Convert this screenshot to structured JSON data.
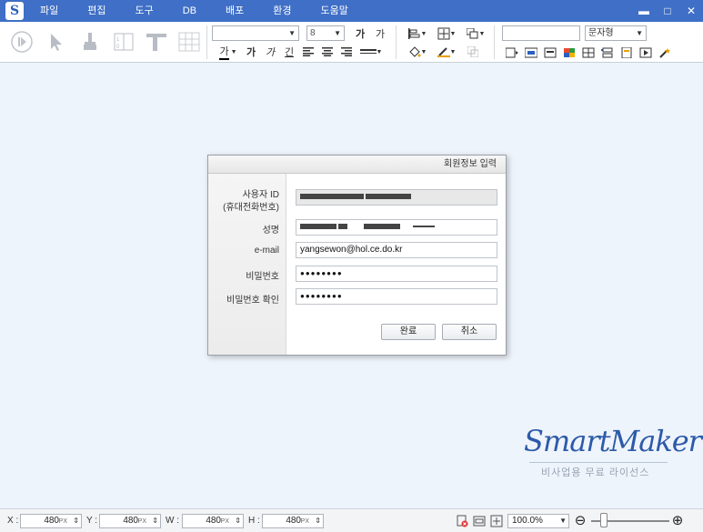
{
  "menu": {
    "items": [
      {
        "label": "파일"
      },
      {
        "label": "편집"
      },
      {
        "label": "도구"
      },
      {
        "label": "DB"
      },
      {
        "label": "배포"
      },
      {
        "label": "환경"
      },
      {
        "label": "도움말"
      }
    ]
  },
  "window_controls": {
    "minimize": "▬",
    "restore": "□",
    "close": "✕"
  },
  "toolbar": {
    "font_name": "",
    "font_size": "8",
    "style_dropdown": "문자형",
    "text_style_box": "",
    "font_color_glyph": "가",
    "bold_glyph": "가",
    "italic_glyph": "가",
    "underline_glyph": "긴",
    "size_up_glyph": "가",
    "size_down_glyph": "가"
  },
  "dialog": {
    "title": "회원정보 입력",
    "fields": [
      {
        "label_line1": "사용자 ID",
        "label_line2": "(휴대전화번호)",
        "value": ""
      },
      {
        "label": "성명",
        "value": ""
      },
      {
        "label": "e-mail",
        "value": "yangsewon@hol.ce.do.kr"
      },
      {
        "label": "비밀번호",
        "value": "●●●●●●●●"
      },
      {
        "label": "비밀번호 확인",
        "value": "●●●●●●●●"
      }
    ],
    "confirm_label": "완료",
    "cancel_label": "취소"
  },
  "watermark": {
    "logo": "SmartMaker",
    "subtitle": "비사업용 무료 라이선스"
  },
  "statusbar": {
    "x_label": "X :",
    "x_value": "480",
    "x_unit": "PX",
    "y_label": "Y :",
    "y_value": "480",
    "y_unit": "PX",
    "w_label": "W :",
    "w_value": "480",
    "w_unit": "PX",
    "h_label": "H :",
    "h_value": "480",
    "h_unit": "PX",
    "zoom": "100.0%",
    "zoom_minus": "⊖",
    "zoom_plus": "⊕"
  },
  "colors": {
    "menubar": "#3f6fc6",
    "canvas": "#eef4fb",
    "brand": "#2c5aa8"
  }
}
